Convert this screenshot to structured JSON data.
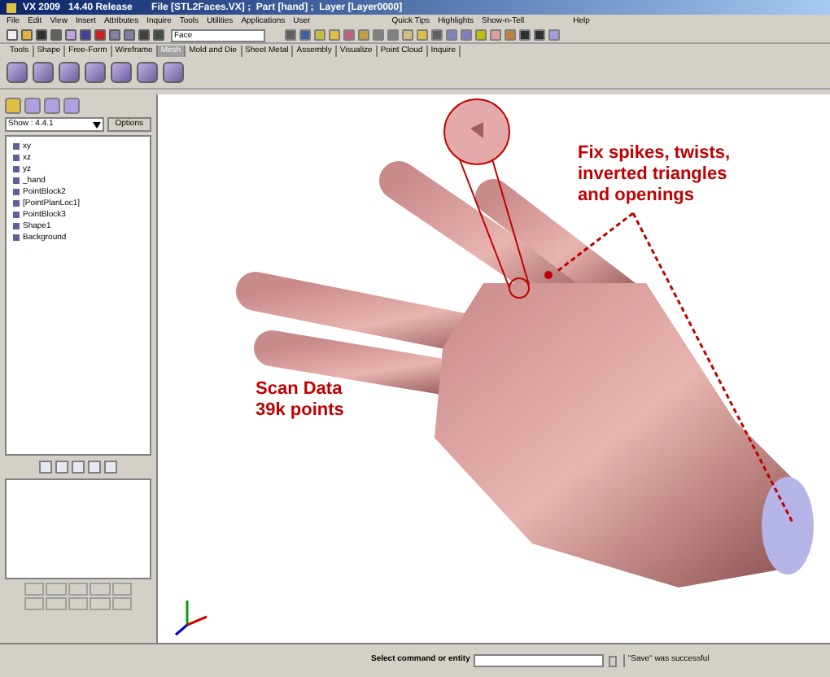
{
  "window": {
    "title": "VX 2009   14.40 Release       File [STL2Faces.VX] ;  Part [hand] ;  Layer [Layer0000]"
  },
  "menu": [
    "File",
    "Edit",
    "View",
    "Insert",
    "Attributes",
    "Inquire",
    "Tools",
    "Utilities",
    "Applications",
    "User"
  ],
  "menu_right": [
    "Quick Tips",
    "Highlights",
    "Show-n-Tell"
  ],
  "menu_help": "Help",
  "toolbar": {
    "filter_value": "Face"
  },
  "tabs": [
    {
      "label": "Tools",
      "selected": false
    },
    {
      "label": "Shape",
      "selected": false
    },
    {
      "label": "Free-Form",
      "selected": false
    },
    {
      "label": "Wireframe",
      "selected": false
    },
    {
      "label": "Mesh",
      "selected": true
    },
    {
      "label": "Mold and Die",
      "selected": false
    },
    {
      "label": "Sheet Metal",
      "selected": false
    },
    {
      "label": "Assembly",
      "selected": false
    },
    {
      "label": "Visualize",
      "selected": false
    },
    {
      "label": "Point Cloud",
      "selected": false
    },
    {
      "label": "Inquire",
      "selected": false
    }
  ],
  "left_panel": {
    "show_value": "Show : 4.4.1",
    "options_button": "Options",
    "tree": [
      {
        "label": "xy"
      },
      {
        "label": "xz"
      },
      {
        "label": "yz"
      },
      {
        "label": "_hand"
      },
      {
        "label": "PointBlock2"
      },
      {
        "label": "[PointPlanLoc1]"
      },
      {
        "label": "PointBlock3"
      },
      {
        "label": "Shape1"
      },
      {
        "label": "Background"
      }
    ]
  },
  "viewport": {
    "annotations": [
      {
        "kind": "scan",
        "text": "Scan Data\n39k points"
      },
      {
        "kind": "fix",
        "text": "Fix spikes, twists,\ninverted triangles\nand openings"
      }
    ]
  },
  "status_bar": {
    "prompt": "Select command or entity",
    "message": "\"Save\" was successful"
  }
}
